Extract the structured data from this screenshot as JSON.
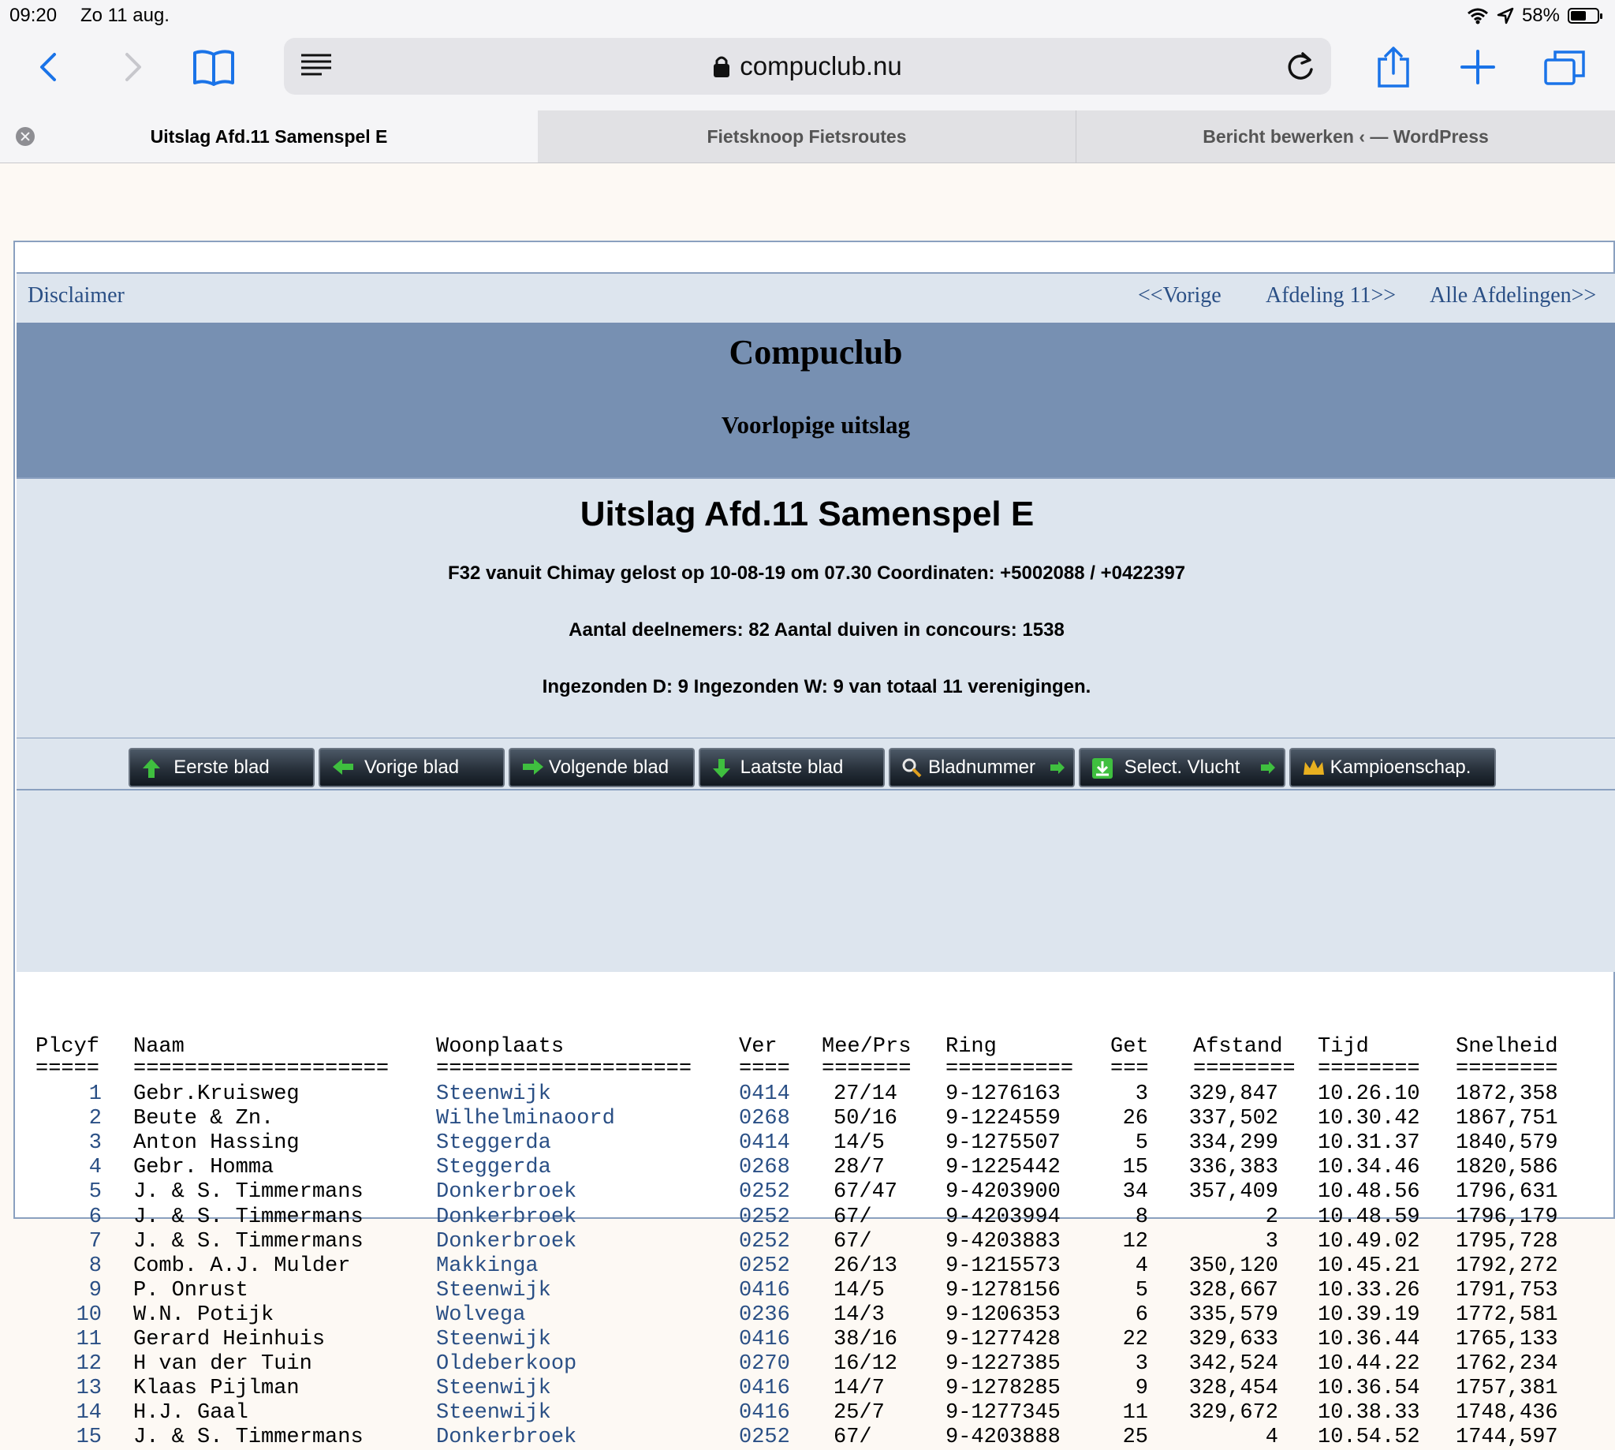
{
  "status_bar": {
    "time": "09:20",
    "date": "Zo 11 aug.",
    "battery": "58%",
    "battery_level": 0.58
  },
  "toolbar": {
    "url": "compuclub.nu",
    "icons": [
      "back-icon",
      "forward-icon",
      "bookmarks-icon",
      "reader-icon",
      "lock-icon",
      "reload-icon",
      "share-icon",
      "new-tab-icon",
      "tabs-icon"
    ]
  },
  "tabs": [
    {
      "label": "Uitslag Afd.11 Samenspel E",
      "active": true
    },
    {
      "label": "Fietsknoop Fietsroutes",
      "active": false
    },
    {
      "label": "Bericht bewerken ‹ — WordPress",
      "active": false
    }
  ],
  "nav": {
    "disclaimer": "Disclaimer",
    "prev": "<<Vorige",
    "afdeling": "Afdeling 11>>",
    "alle": "Alle Afdelingen>>"
  },
  "hero": {
    "title": "Compuclub",
    "subtitle": "Voorlopige uitslag"
  },
  "info": {
    "title": "Uitslag Afd.11 Samenspel E",
    "line1": "F32 vanuit Chimay gelost op 10-08-19 om 07.30 Coordinaten: +5002088 / +0422397",
    "line2": "Aantal deelnemers: 82 Aantal duiven in concours: 1538",
    "line3": "Ingezonden D: 9 Ingezonden W: 9 van totaal 11 verenigingen."
  },
  "buttons": [
    {
      "label": "Eerste blad",
      "icon": "arrow-up-icon"
    },
    {
      "label": "Vorige blad",
      "icon": "arrow-left-icon"
    },
    {
      "label": "Volgende blad",
      "icon": "arrow-right-icon"
    },
    {
      "label": "Laatste blad",
      "icon": "arrow-down-icon"
    },
    {
      "label": "Bladnummer",
      "icon": "magnifier-icon"
    },
    {
      "label": "Select. Vlucht",
      "icon": "download-icon"
    },
    {
      "label": "Kampioenschap.",
      "icon": "crown-icon"
    }
  ],
  "table": {
    "headers": [
      "Plcyf",
      "Naam",
      "Woonplaats",
      "Ver",
      "Mee/Prs",
      "Ring",
      "Get",
      "Afstand",
      "Tijd",
      "Snelheid"
    ],
    "separators": [
      "=====",
      "====================",
      "====================",
      "====",
      "=======",
      "==========",
      "===",
      "========",
      "========",
      "========"
    ],
    "rows": [
      [
        "1",
        "Gebr.Kruisweg",
        "Steenwijk",
        "0414",
        "27/14",
        "9-1276163",
        "3",
        "329,847",
        "10.26.10",
        "1872,358"
      ],
      [
        "2",
        "Beute & Zn.",
        "Wilhelminaoord",
        "0268",
        "50/16",
        "9-1224559",
        "26",
        "337,502",
        "10.30.42",
        "1867,751"
      ],
      [
        "3",
        "Anton Hassing",
        "Steggerda",
        "0414",
        "14/5",
        "9-1275507",
        "5",
        "334,299",
        "10.31.37",
        "1840,579"
      ],
      [
        "4",
        "Gebr. Homma",
        "Steggerda",
        "0268",
        "28/7",
        "9-1225442",
        "15",
        "336,383",
        "10.34.46",
        "1820,586"
      ],
      [
        "5",
        "J. & S. Timmermans",
        "Donkerbroek",
        "0252",
        "67/47",
        "9-4203900",
        "34",
        "357,409",
        "10.48.56",
        "1796,631"
      ],
      [
        "6",
        "J. & S. Timmermans",
        "Donkerbroek",
        "0252",
        "67/",
        "9-4203994",
        "8",
        "2",
        "10.48.59",
        "1796,179"
      ],
      [
        "7",
        "J. & S. Timmermans",
        "Donkerbroek",
        "0252",
        "67/",
        "9-4203883",
        "12",
        "3",
        "10.49.02",
        "1795,728"
      ],
      [
        "8",
        "Comb. A.J. Mulder",
        "Makkinga",
        "0252",
        "26/13",
        "9-1215573",
        "4",
        "350,120",
        "10.45.21",
        "1792,272"
      ],
      [
        "9",
        "P. Onrust",
        "Steenwijk",
        "0416",
        "14/5",
        "9-1278156",
        "5",
        "328,667",
        "10.33.26",
        "1791,753"
      ],
      [
        "10",
        "W.N. Potijk",
        "Wolvega",
        "0236",
        "14/3",
        "9-1206353",
        "6",
        "335,579",
        "10.39.19",
        "1772,581"
      ],
      [
        "11",
        "Gerard Heinhuis",
        "Steenwijk",
        "0416",
        "38/16",
        "9-1277428",
        "22",
        "329,633",
        "10.36.44",
        "1765,133"
      ],
      [
        "12",
        "H van der Tuin",
        "Oldeberkoop",
        "0270",
        "16/12",
        "9-1227385",
        "3",
        "342,524",
        "10.44.22",
        "1762,234"
      ],
      [
        "13",
        "Klaas Pijlman",
        "Steenwijk",
        "0416",
        "14/7",
        "9-1278285",
        "9",
        "328,454",
        "10.36.54",
        "1757,381"
      ],
      [
        "14",
        "H.J. Gaal",
        "Steenwijk",
        "0416",
        "25/7",
        "9-1277345",
        "11",
        "329,672",
        "10.38.33",
        "1748,436"
      ],
      [
        "15",
        "J. & S. Timmermans",
        "Donkerbroek",
        "0252",
        "67/",
        "9-4203888",
        "25",
        "4",
        "10.54.52",
        "1744,597"
      ]
    ]
  }
}
